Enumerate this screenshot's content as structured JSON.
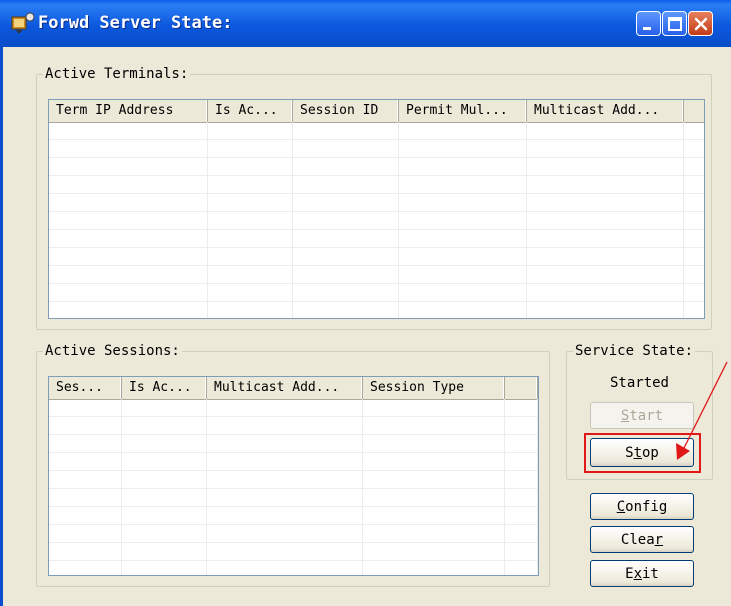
{
  "window": {
    "title": "Forwd Server State:",
    "controls": [
      "minimize-icon",
      "maximize-icon",
      "close-icon"
    ]
  },
  "active_terminals": {
    "legend": "Active Terminals:",
    "columns": [
      "Term IP Address",
      "Is Ac...",
      "Session ID",
      "Permit Mul...",
      "Multicast Add..."
    ],
    "rows": []
  },
  "active_sessions": {
    "legend": "Active Sessions:",
    "columns": [
      "Ses...",
      "Is Ac...",
      "Multicast Add...",
      "Session Type"
    ],
    "rows": []
  },
  "service_state": {
    "legend": "Service State:",
    "status": "Started",
    "start_button": {
      "label": "Start",
      "mnemonic": "S",
      "enabled": false
    },
    "stop_button": {
      "label": "Stop",
      "mnemonic": "t",
      "enabled": true
    }
  },
  "buttons": {
    "config": {
      "label": "Config",
      "mnemonic": "C"
    },
    "clear": {
      "label": "Clear",
      "mnemonic": "r"
    },
    "exit": {
      "label": "Exit",
      "mnemonic": "x"
    }
  },
  "annotation": {
    "color": "#e01818",
    "target": "stop-button"
  },
  "colors": {
    "title_bar": "#0b58de",
    "dialog_bg": "#ece9d8",
    "listview_border": "#7f9db9"
  }
}
